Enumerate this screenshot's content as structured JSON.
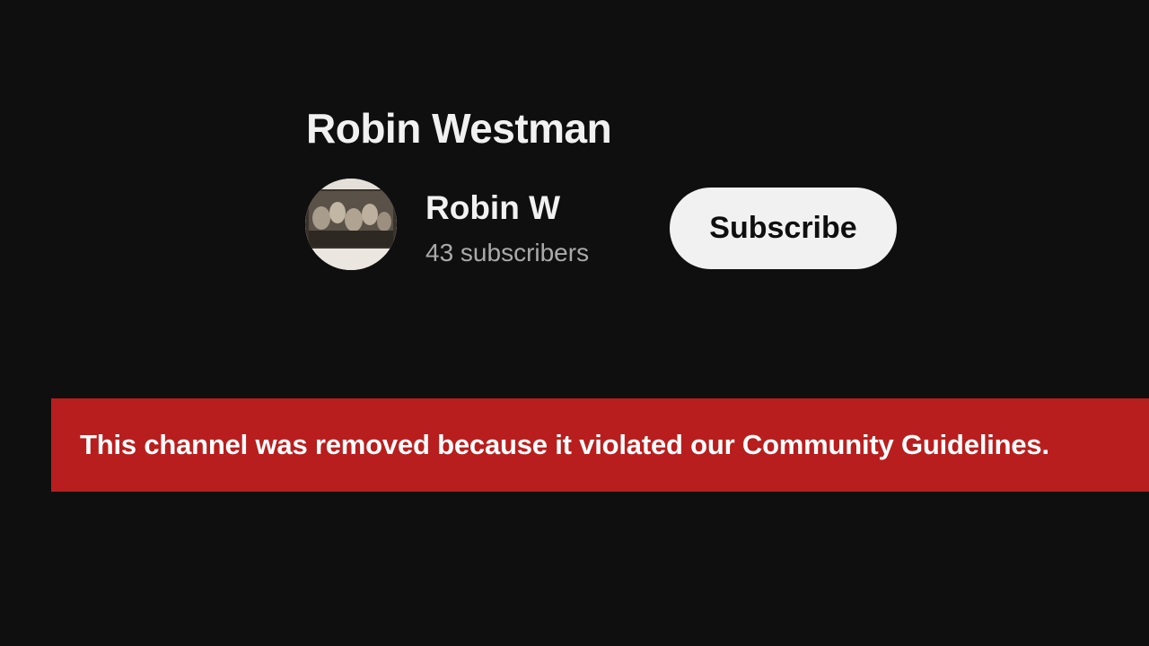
{
  "video": {
    "title": "Robin Westman"
  },
  "channel": {
    "name": "Robin W",
    "subscribers": "43 subscribers",
    "subscribe_label": "Subscribe"
  },
  "notice": {
    "text": "This channel was removed because it violated our Community Guidelines."
  }
}
